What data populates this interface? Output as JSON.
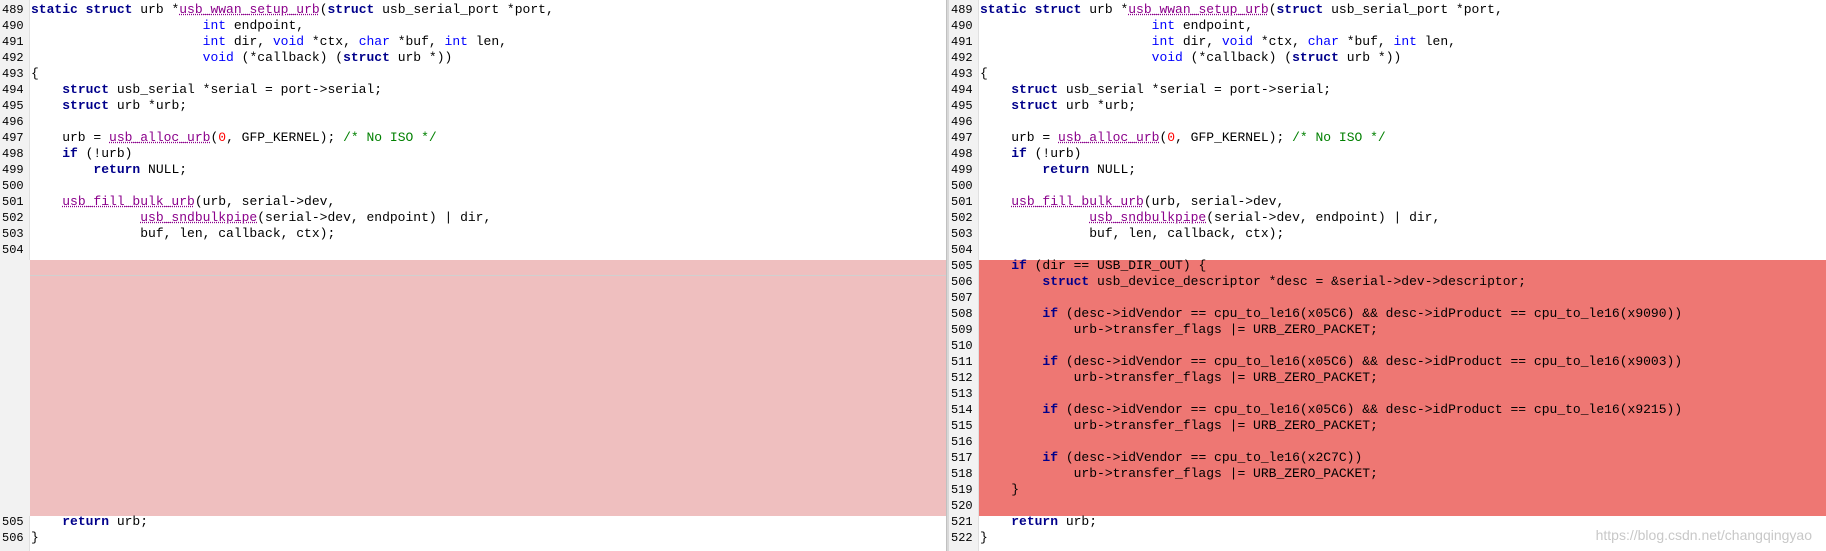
{
  "left": {
    "lines": [
      {
        "n": "489",
        "t": "static struct urb *usb_wwan_setup_urb(struct usb_serial_port *port,"
      },
      {
        "n": "490",
        "t": "                      int endpoint,"
      },
      {
        "n": "491",
        "t": "                      int dir, void *ctx, char *buf, int len,"
      },
      {
        "n": "492",
        "t": "                      void (*callback) (struct urb *))"
      },
      {
        "n": "493",
        "t": "{"
      },
      {
        "n": "494",
        "t": "    struct usb_serial *serial = port->serial;"
      },
      {
        "n": "495",
        "t": "    struct urb *urb;"
      },
      {
        "n": "496",
        "t": ""
      },
      {
        "n": "497",
        "t": "    urb = usb_alloc_urb(0, GFP_KERNEL); /* No ISO */"
      },
      {
        "n": "498",
        "t": "    if (!urb)"
      },
      {
        "n": "499",
        "t": "        return NULL;"
      },
      {
        "n": "500",
        "t": ""
      },
      {
        "n": "501",
        "t": "    usb_fill_bulk_urb(urb, serial->dev,"
      },
      {
        "n": "502",
        "t": "              usb_sndbulkpipe(serial->dev, endpoint) | dir,"
      },
      {
        "n": "503",
        "t": "              buf, len, callback, ctx);"
      },
      {
        "n": "504",
        "t": ""
      },
      {
        "n": "505",
        "t": "    return urb;"
      },
      {
        "n": "506",
        "t": "}"
      }
    ]
  },
  "right": {
    "lines": [
      {
        "n": "489",
        "t": "static struct urb *usb_wwan_setup_urb(struct usb_serial_port *port,"
      },
      {
        "n": "490",
        "t": "                      int endpoint,"
      },
      {
        "n": "491",
        "t": "                      int dir, void *ctx, char *buf, int len,"
      },
      {
        "n": "492",
        "t": "                      void (*callback) (struct urb *))"
      },
      {
        "n": "493",
        "t": "{"
      },
      {
        "n": "494",
        "t": "    struct usb_serial *serial = port->serial;"
      },
      {
        "n": "495",
        "t": "    struct urb *urb;"
      },
      {
        "n": "496",
        "t": ""
      },
      {
        "n": "497",
        "t": "    urb = usb_alloc_urb(0, GFP_KERNEL); /* No ISO */"
      },
      {
        "n": "498",
        "t": "    if (!urb)"
      },
      {
        "n": "499",
        "t": "        return NULL;"
      },
      {
        "n": "500",
        "t": ""
      },
      {
        "n": "501",
        "t": "    usb_fill_bulk_urb(urb, serial->dev,"
      },
      {
        "n": "502",
        "t": "              usb_sndbulkpipe(serial->dev, endpoint) | dir,"
      },
      {
        "n": "503",
        "t": "              buf, len, callback, ctx);"
      },
      {
        "n": "504",
        "t": ""
      },
      {
        "n": "505",
        "t": "    if (dir == USB_DIR_OUT) {"
      },
      {
        "n": "506",
        "t": "        struct usb_device_descriptor *desc = &serial->dev->descriptor;"
      },
      {
        "n": "507",
        "t": ""
      },
      {
        "n": "508",
        "t": "        if (desc->idVendor == cpu_to_le16(0x05C6) && desc->idProduct == cpu_to_le16(0x9090))"
      },
      {
        "n": "509",
        "t": "            urb->transfer_flags |= URB_ZERO_PACKET;"
      },
      {
        "n": "510",
        "t": ""
      },
      {
        "n": "511",
        "t": "        if (desc->idVendor == cpu_to_le16(0x05C6) && desc->idProduct == cpu_to_le16(0x9003))"
      },
      {
        "n": "512",
        "t": "            urb->transfer_flags |= URB_ZERO_PACKET;"
      },
      {
        "n": "513",
        "t": ""
      },
      {
        "n": "514",
        "t": "        if (desc->idVendor == cpu_to_le16(0x05C6) && desc->idProduct == cpu_to_le16(0x9215))"
      },
      {
        "n": "515",
        "t": "            urb->transfer_flags |= URB_ZERO_PACKET;"
      },
      {
        "n": "516",
        "t": ""
      },
      {
        "n": "517",
        "t": "        if (desc->idVendor == cpu_to_le16(0x2C7C))"
      },
      {
        "n": "518",
        "t": "            urb->transfer_flags |= URB_ZERO_PACKET;"
      },
      {
        "n": "519",
        "t": "    }"
      },
      {
        "n": "520",
        "t": ""
      },
      {
        "n": "521",
        "t": "    return urb;"
      },
      {
        "n": "522",
        "t": "}"
      }
    ]
  },
  "watermark": "https://blog.csdn.net/changqingyao",
  "colors": {
    "removed_bg": "#efbfbf",
    "added_bg": "#ee7773",
    "keyword": "#00008b",
    "type": "#0000ff",
    "function": "#8b008b",
    "number": "#ff0000",
    "comment": "#008000"
  }
}
